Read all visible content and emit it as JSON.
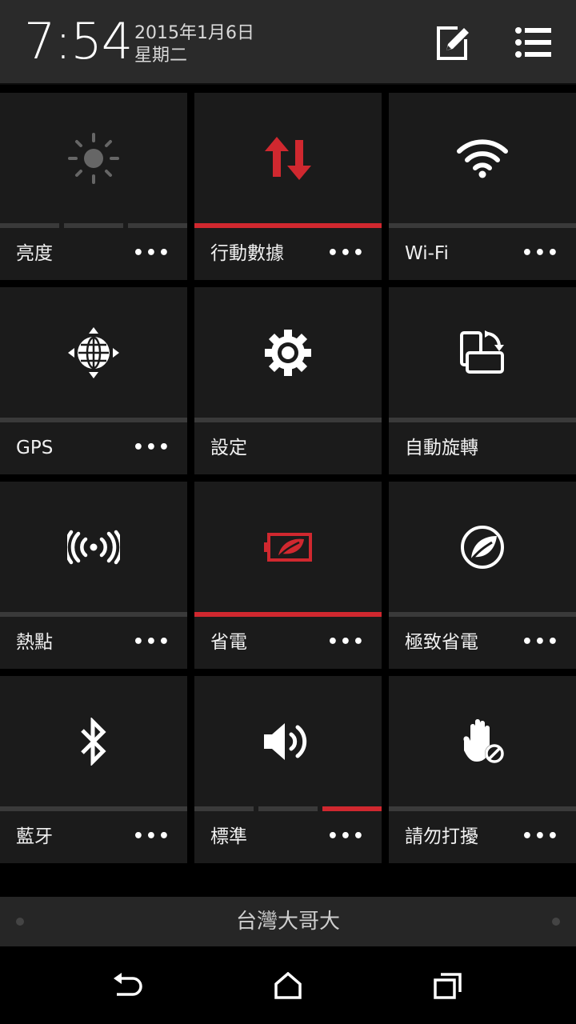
{
  "status": {
    "time": "7:54",
    "date": "2015年1月6日",
    "weekday": "星期二"
  },
  "header_actions": {
    "edit_icon": "edit-icon",
    "menu_icon": "list-menu-icon"
  },
  "tiles": [
    {
      "label": "亮度",
      "more": "•••",
      "icon": "brightness-icon"
    },
    {
      "label": "行動數據",
      "more": "•••",
      "icon": "mobile-data-icon"
    },
    {
      "label": "Wi-Fi",
      "more": "•••",
      "icon": "wifi-icon"
    },
    {
      "label": "GPS",
      "more": "•••",
      "icon": "gps-icon"
    },
    {
      "label": "設定",
      "icon": "settings-icon"
    },
    {
      "label": "自動旋轉",
      "icon": "auto-rotate-icon"
    },
    {
      "label": "熱點",
      "more": "•••",
      "icon": "hotspot-icon"
    },
    {
      "label": "省電",
      "more": "•••",
      "icon": "power-saver-icon"
    },
    {
      "label": "極致省電",
      "more": "•••",
      "icon": "extreme-power-saver-icon"
    },
    {
      "label": "藍牙",
      "more": "•••",
      "icon": "bluetooth-icon"
    },
    {
      "label": "標準",
      "more": "•••",
      "icon": "volume-icon"
    },
    {
      "label": "請勿打擾",
      "more": "•••",
      "icon": "do-not-disturb-icon"
    }
  ],
  "active_tiles": [
    "行動數據",
    "省電"
  ],
  "colors": {
    "accent": "#d0282f",
    "tile_bg": "#1b1b1b",
    "header_bg": "#2a2a2a"
  },
  "carrier": "台灣大哥大",
  "nav": {
    "back_icon": "back-icon",
    "home_icon": "home-icon",
    "recents_icon": "recents-icon"
  }
}
